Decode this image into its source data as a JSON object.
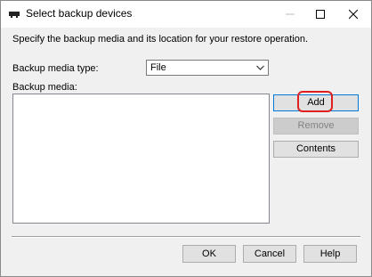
{
  "window": {
    "title": "Select backup devices",
    "title_icon": "backup-device-icon",
    "controls": [
      "minimize-icon",
      "maximize-icon",
      "close-icon"
    ]
  },
  "description": "Specify the backup media and its location for your restore operation.",
  "media_type": {
    "label": "Backup media type:",
    "selected": "File",
    "icon": "chevron-down-icon"
  },
  "media_list": {
    "label": "Backup media:",
    "items": []
  },
  "side_buttons": {
    "add": "Add",
    "remove": "Remove",
    "contents": "Contents"
  },
  "footer_buttons": {
    "ok": "OK",
    "cancel": "Cancel",
    "help": "Help"
  },
  "colors": {
    "highlight": "#e02020",
    "focus_border": "#0078d7"
  }
}
